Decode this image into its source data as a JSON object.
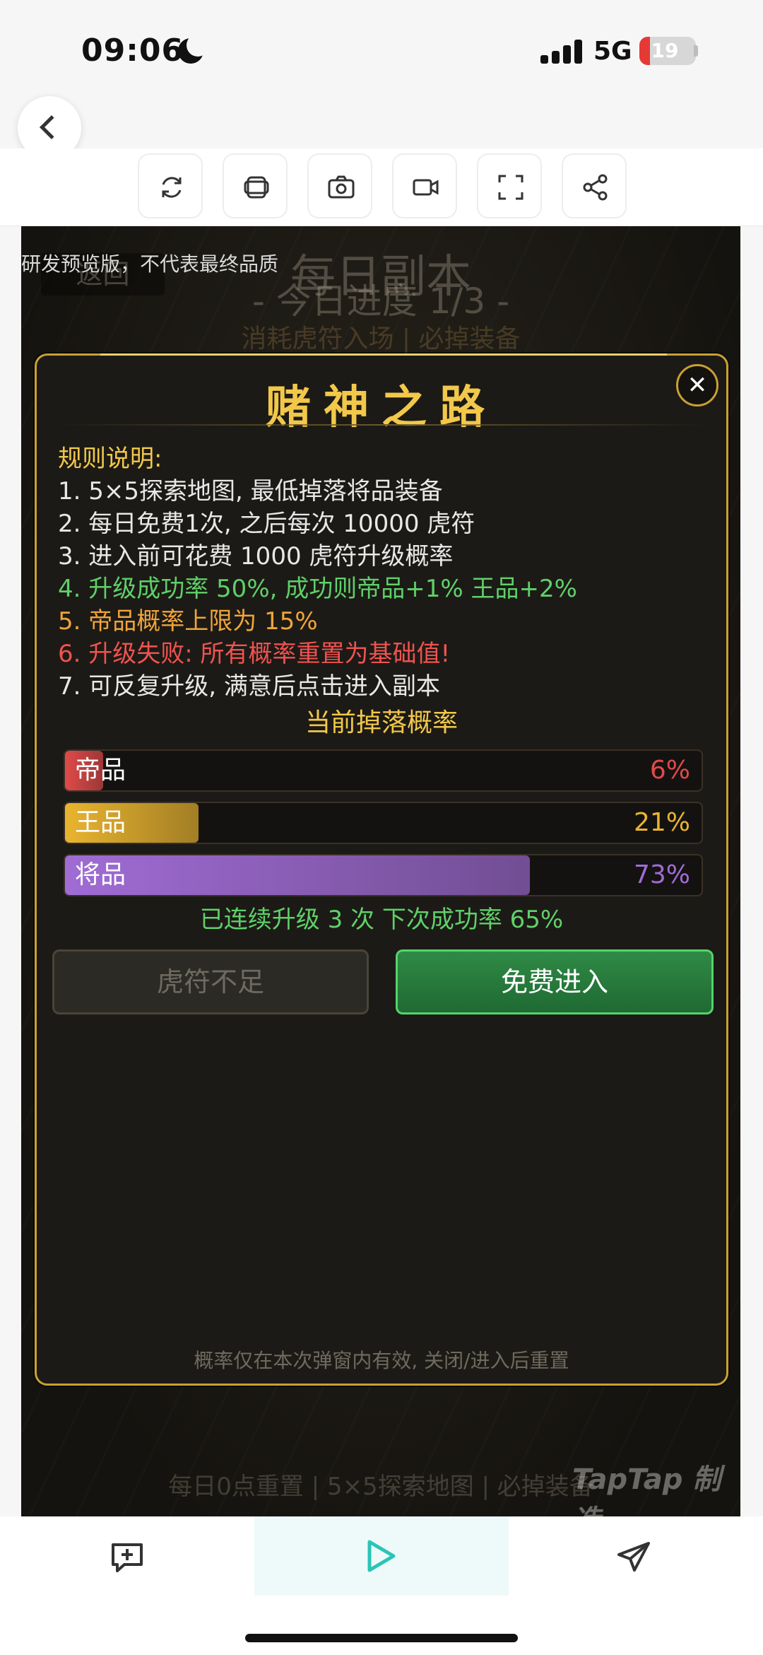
{
  "status_bar": {
    "time": "09:06",
    "network": "5G",
    "battery": "19",
    "battery_level": 0.19,
    "icons": [
      "moon-icon",
      "signal-icon",
      "battery-icon"
    ]
  },
  "toolbar": {
    "icons": [
      "refresh-icon",
      "copy-icon",
      "screenshot-icon",
      "video-icon",
      "fullscreen-icon",
      "share-icon"
    ]
  },
  "game": {
    "preview_notice": "研发预览版，不代表最终品质",
    "bg_title": "每日副本",
    "bg_progress": "- 今日进度 1/3 -",
    "bg_subtitle": "消耗虎符入场 | 必掉装备",
    "bg_back": "返回",
    "bg_footer": "每日0点重置 | 5×5探索地图 | 必掉装备",
    "watermark": "TapTap 制造"
  },
  "modal": {
    "title": "赌神之路",
    "close": "✕",
    "rules_heading": "规则说明:",
    "rules": [
      "1. 5×5探索地图, 最低掉落将品装备",
      "2. 每日免费1次, 之后每次 10000 虎符",
      "3. 进入前可花费 1000 虎符升级概率",
      "4. 升级成功率 50%, 成功则帝品+1% 王品+2%",
      "5. 帝品概率上限为 15%",
      "6. 升级失败: 所有概率重置为基础值!",
      "7. 可反复升级, 满意后点击进入副本"
    ],
    "drop_heading": "当前掉落概率",
    "bars": [
      {
        "label": "帝品",
        "value": "6%",
        "fraction": 0.06,
        "color": "#e04a4a"
      },
      {
        "label": "王品",
        "value": "21%",
        "fraction": 0.21,
        "color": "#e9b42f"
      },
      {
        "label": "将品",
        "value": "73%",
        "fraction": 0.73,
        "color": "#a06cd5"
      }
    ],
    "streak_text": "已连续升级 3 次  下次成功率 65%",
    "btn_insufficient": "虎符不足",
    "btn_enter": "免费进入",
    "footnote": "概率仅在本次弹窗内有效, 关闭/进入后重置"
  },
  "bottom_bar": {
    "icons": [
      "comment-icon",
      "play-icon",
      "send-icon"
    ]
  }
}
